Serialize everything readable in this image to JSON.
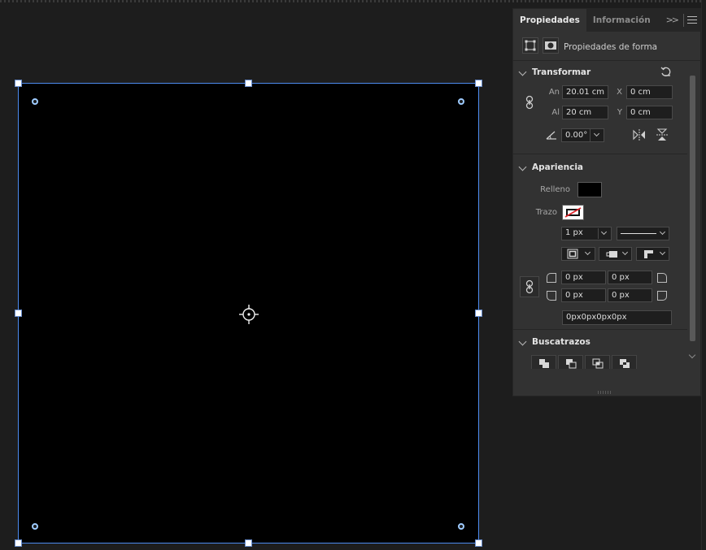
{
  "panel": {
    "tabs": [
      {
        "label": "Propiedades",
        "active": true
      },
      {
        "label": "Información",
        "active": false
      }
    ],
    "expand_icon": "double-chevron-right-icon",
    "menu_icon": "hamburger-menu-icon",
    "shape_properties_label": "Propiedades de forma"
  },
  "transform": {
    "title": "Transformar",
    "width_label": "An",
    "width_value": "20.01 cm",
    "height_label": "Al",
    "height_value": "20 cm",
    "x_label": "X",
    "x_value": "0 cm",
    "y_label": "Y",
    "y_value": "0 cm",
    "angle_value": "0.00°"
  },
  "appearance": {
    "title": "Apariencia",
    "fill_label": "Relleno",
    "fill_color": "#000000",
    "stroke_label": "Trazo",
    "stroke_width": "1 px",
    "corner_tl": "0 px",
    "corner_tr": "0 px",
    "corner_bl": "0 px",
    "corner_br": "0 px",
    "corners_combined": "0px0px0px0px"
  },
  "pathfinder": {
    "title": "Buscatrazos"
  },
  "colors": {
    "selection": "#4d8cf0",
    "artboard": "#000000",
    "panel_bg": "#323232",
    "canvas_bg": "#1d1d1d"
  }
}
